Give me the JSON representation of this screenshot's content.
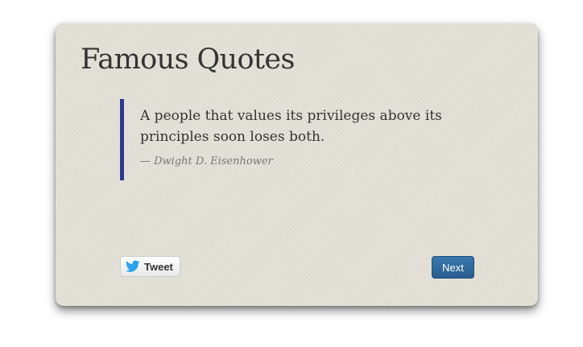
{
  "title": "Famous Quotes",
  "quote": {
    "text": "A people that values its privileges above its principles soon loses both.",
    "author": "— Dwight D. Eisenhower"
  },
  "actions": {
    "tweet_label": "Tweet",
    "next_label": "Next"
  },
  "colors": {
    "card_background": "#e3e0d7",
    "quote_accent": "#2b3a8f",
    "next_button": "#2f6ca3",
    "twitter_blue": "#2aa3ef"
  },
  "icons": {
    "tweet": "twitter-bird-icon"
  }
}
